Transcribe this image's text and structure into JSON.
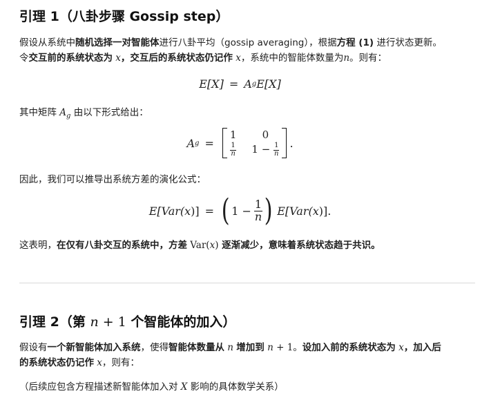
{
  "lemma1": {
    "heading": "引理 1（八卦步骤 Gossip step）",
    "p1": {
      "a": "假设从系统中",
      "b": "随机选择一对智能体",
      "c": "进行八卦平均（gossip averaging），根据",
      "d": "方程 (1)",
      "e": " 进行状态更新。",
      "f": "令",
      "g": "交互前的系统状态为",
      "var_x": "x",
      "h": "，",
      "i": "交互后的系统状态仍记作",
      "j": "，系统中的智能体数量为",
      "var_n": "n",
      "k": "。则有："
    },
    "eq1": {
      "lhs": "E[X]",
      "eq": "=",
      "rhs_a": "A",
      "rhs_sub": "g",
      "rhs_b": "E[X]"
    },
    "p2": {
      "a": "其中矩阵",
      "var": "A",
      "sub": "g",
      "b": " 由以下形式给出："
    },
    "matrix": {
      "lhs": "A",
      "lhs_sub": "g",
      "eq": "=",
      "r1c1": "1",
      "r1c2": "0",
      "r2c1_num": "1",
      "r2c1_den": "n",
      "r2c2_a": "1 −",
      "r2c2_num": "1",
      "r2c2_den": "n",
      "tail": "."
    },
    "p3": "因此，我们可以推导出系统方差的演化公式：",
    "eq2": {
      "lhs": "E[Var(",
      "x": "x",
      "lhs_close": ")]",
      "eq": "=",
      "one_minus": "1 −",
      "num": "1",
      "den": "n",
      "rhs": "E[Var(",
      "rhs_close": ")]."
    },
    "p4": {
      "a": "这表明，",
      "b": "在仅有八卦交互的系统中，方差",
      "var": "Var(",
      "x": "x",
      "close": ")",
      "c": " 逐渐减少，意味着系统状态趋于共识。"
    }
  },
  "lemma2": {
    "heading_a": "引理 2（第 ",
    "heading_n": "n",
    "heading_plus": " + 1",
    "heading_b": " 个智能体的加入）",
    "p1": {
      "a": "假设有",
      "b": "一个新智能体加入系统",
      "c": "，使得",
      "d": "智能体数量从",
      "var_n": "n",
      "e": "增加到",
      "var_n2": "n",
      "plus": " + 1",
      "f": "。",
      "g": "设加入前的系统状态为",
      "var_x": "x",
      "h": "，",
      "i": "加入后",
      "j": "的系统状态仍记作",
      "var_x2": "x",
      "k": "，则有："
    },
    "p2": {
      "a": "（后续应包含方程描述新智能体加入对 ",
      "var": "X",
      "b": " 影响的具体数学关系）"
    }
  }
}
